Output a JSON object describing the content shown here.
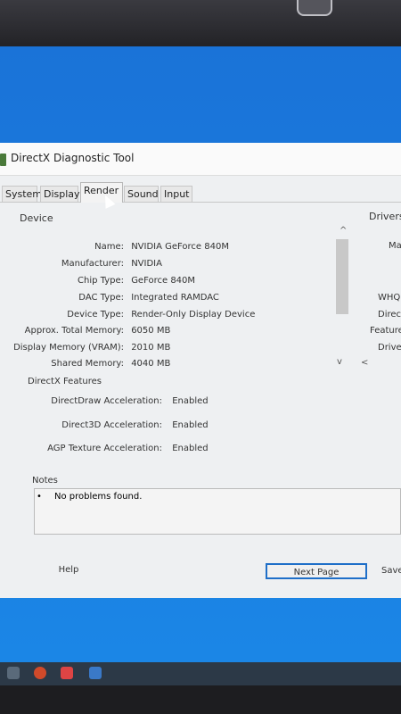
{
  "window": {
    "title": "DirectX Diagnostic Tool"
  },
  "tabs": [
    {
      "label": "System"
    },
    {
      "label": "Display"
    },
    {
      "label": "Render"
    },
    {
      "label": "Sound"
    },
    {
      "label": "Input"
    }
  ],
  "device": {
    "group_label": "Device",
    "rows": [
      {
        "label": "Name:",
        "value": "NVIDIA GeForce 840M"
      },
      {
        "label": "Manufacturer:",
        "value": "NVIDIA"
      },
      {
        "label": "Chip Type:",
        "value": "GeForce 840M"
      },
      {
        "label": "DAC Type:",
        "value": "Integrated RAMDAC"
      },
      {
        "label": "Device Type:",
        "value": "Render-Only Display Device"
      },
      {
        "label": "Approx. Total Memory:",
        "value": "6050 MB"
      },
      {
        "label": "Display Memory (VRAM):",
        "value": "2010 MB"
      },
      {
        "label": "Shared Memory:",
        "value": "4040 MB"
      }
    ]
  },
  "drivers": {
    "group_label": "Drivers",
    "rows": [
      "Ma",
      "WHQ",
      "Direc",
      "Feature",
      "Drive"
    ]
  },
  "features": {
    "group_label": "DirectX Features",
    "rows": [
      {
        "label": "DirectDraw Acceleration:",
        "value": "Enabled"
      },
      {
        "label": "Direct3D Acceleration:",
        "value": "Enabled"
      },
      {
        "label": "AGP Texture Acceleration:",
        "value": "Enabled"
      }
    ]
  },
  "notes": {
    "group_label": "Notes",
    "items": [
      "No problems found."
    ]
  },
  "buttons": {
    "help": "Help",
    "next_page": "Next Page",
    "save": "Save"
  },
  "scroll": {
    "up": "^",
    "down": "v",
    "left": "<"
  }
}
